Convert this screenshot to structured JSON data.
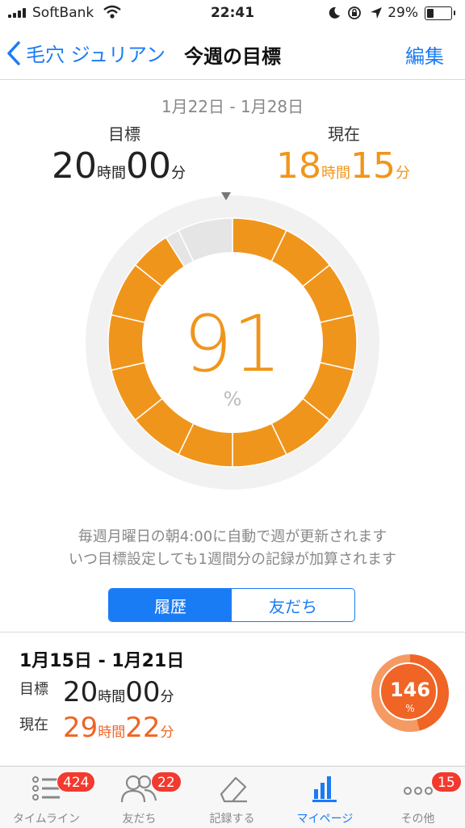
{
  "status_bar": {
    "carrier": "SoftBank",
    "time": "22:41",
    "battery": "29%",
    "battery_level": 0.29
  },
  "nav": {
    "back_label": "毛穴 ジュリアン",
    "title": "今週の目標",
    "edit_label": "編集"
  },
  "week": {
    "date_range": "1月22日 - 1月28日",
    "goal_label": "目標",
    "goal_hours": "20",
    "goal_minutes": "00",
    "current_label": "現在",
    "current_hours": "18",
    "current_minutes": "15",
    "hour_unit": "時間",
    "minute_unit": "分",
    "percent": "91",
    "percent_sign": "%",
    "progress": 0.91,
    "segments": 14,
    "colors": {
      "filled": "#f0951b",
      "empty": "#e5e5e5",
      "track": "#f1f1f1"
    }
  },
  "info": {
    "line1": "毎週月曜日の朝4:00に自動で週が更新されます",
    "line2": "いつ目標設定しても1週間分の記録が加算されます"
  },
  "segmented": {
    "history": "履歴",
    "friends": "友だち"
  },
  "history": [
    {
      "date_range": "1月15日 - 1月21日",
      "goal_label": "目標",
      "goal_hours": "20",
      "goal_minutes": "00",
      "current_label": "現在",
      "current_hours": "29",
      "current_minutes": "22",
      "percent": "146",
      "percent_sign": "%"
    }
  ],
  "tabbar": {
    "tabs": [
      {
        "label": "タイムライン",
        "icon": "list-icon",
        "badge": "424"
      },
      {
        "label": "友だち",
        "icon": "people-icon",
        "badge": "22"
      },
      {
        "label": "記録する",
        "icon": "eraser-icon",
        "badge": ""
      },
      {
        "label": "マイページ",
        "icon": "bar-chart-icon",
        "badge": ""
      },
      {
        "label": "その他",
        "icon": "more-icon",
        "badge": "15"
      }
    ],
    "active_index": 3
  }
}
